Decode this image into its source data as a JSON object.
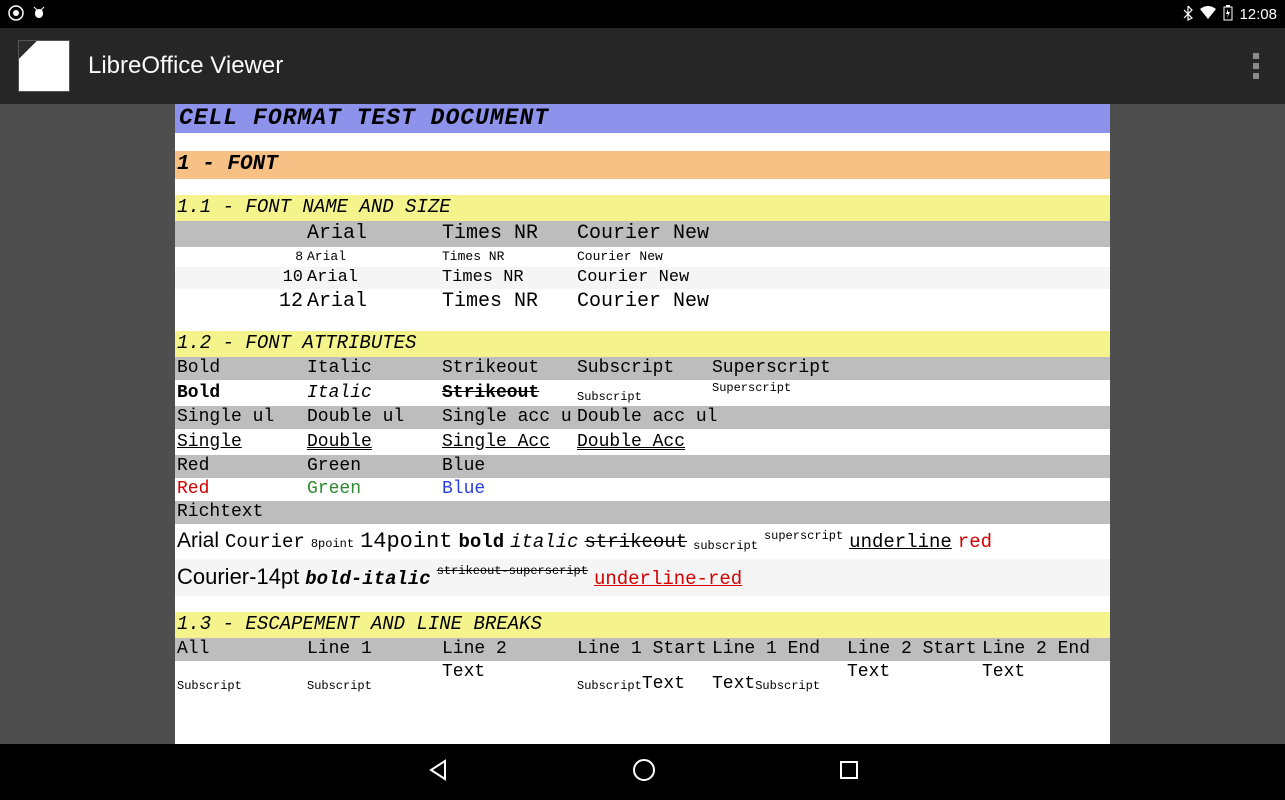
{
  "status": {
    "clock": "12:08"
  },
  "app": {
    "title": "LibreOffice Viewer"
  },
  "doc": {
    "title": "CELL FORMAT TEST DOCUMENT",
    "s1": "1 - FONT",
    "s11": "1.1 - FONT NAME AND SIZE",
    "fonts_header": {
      "a": "Arial",
      "b": "Times NR",
      "c": "Courier New"
    },
    "sizes": {
      "r0": {
        "sz": "8",
        "a": "Arial",
        "b": "Times NR",
        "c": "Courier New"
      },
      "r1": {
        "sz": "10",
        "a": "Arial",
        "b": "Times NR",
        "c": "Courier New"
      },
      "r2": {
        "sz": "12",
        "a": "Arial",
        "b": "Times NR",
        "c": "Courier New"
      }
    },
    "s12": "1.2 - FONT ATTRIBUTES",
    "attr_h": {
      "a": "Bold",
      "b": "Italic",
      "c": "Strikeout",
      "d": "Subscript",
      "e": "Superscript"
    },
    "attr_v": {
      "a": "Bold",
      "b": "Italic",
      "c": "Strikeout",
      "d": "Subscript",
      "e": "Superscript"
    },
    "ul_h": {
      "a": "Single ul",
      "b": "Double ul",
      "c": "Single acc u",
      "d": "Double acc ul"
    },
    "ul_v": {
      "a": "Single",
      "b": "Double",
      "c": "Single Acc",
      "d": "Double Acc"
    },
    "col_h": {
      "a": "Red",
      "b": "Green",
      "c": "Blue"
    },
    "col_v": {
      "a": "Red",
      "b": "Green",
      "c": "Blue"
    },
    "rich_h": "Richtext",
    "rich1": {
      "a": "Arial",
      "b": "Courier",
      "c": "8point",
      "d": "14point",
      "e": "bold",
      "f": "italic",
      "g": "strikeout",
      "h": "subscript",
      "i": "superscript",
      "j": "underline",
      "k": "red"
    },
    "rich2": {
      "a": "Courier-14pt",
      "b": "bold-italic",
      "c": "strikeout-superscript",
      "d": "underline-red"
    },
    "s13": "1.3 - ESCAPEMENT AND LINE BREAKS",
    "esc_h": {
      "a": "All",
      "b": "Line 1",
      "c": "Line 2",
      "d": "Line 1 Start",
      "e": "Line 1 End",
      "f": "Line 2 Start",
      "g": "Line 2 End"
    },
    "esc_v": {
      "a": "Subscript",
      "b": "Subscript",
      "c": "Text",
      "d1": "Subscript",
      "d2": "Text",
      "e1": "Text",
      "e2": "Subscript",
      "f": "Text",
      "g": "Text"
    }
  }
}
